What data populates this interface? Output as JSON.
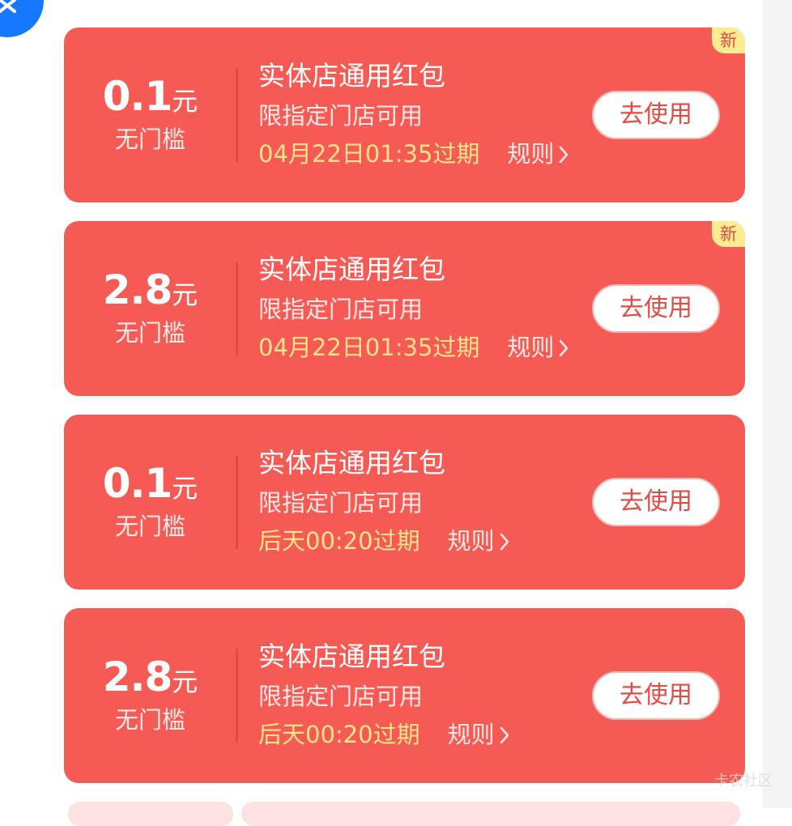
{
  "coupons": [
    {
      "amount": "0.1",
      "unit": "元",
      "threshold": "无门槛",
      "title": "实体店通用红包",
      "desc": "限指定门店可用",
      "expiry": "04月22日01:35过期",
      "rules_label": "规则",
      "button_label": "去使用",
      "badge": "新"
    },
    {
      "amount": "2.8",
      "unit": "元",
      "threshold": "无门槛",
      "title": "实体店通用红包",
      "desc": "限指定门店可用",
      "expiry": "04月22日01:35过期",
      "rules_label": "规则",
      "button_label": "去使用",
      "badge": "新"
    },
    {
      "amount": "0.1",
      "unit": "元",
      "threshold": "无门槛",
      "title": "实体店通用红包",
      "desc": "限指定门店可用",
      "expiry": "后天00:20过期",
      "rules_label": "规则",
      "button_label": "去使用"
    },
    {
      "amount": "2.8",
      "unit": "元",
      "threshold": "无门槛",
      "title": "实体店通用红包",
      "desc": "限指定门店可用",
      "expiry": "后天00:20过期",
      "rules_label": "规则",
      "button_label": "去使用"
    }
  ],
  "icons": {
    "corner": "close-icon",
    "rules": "chevron-right-icon"
  },
  "colors": {
    "card": "#f65a55",
    "expiry_text": "#ffe48a",
    "button_text": "#e34b44",
    "badge": "#ffec8f",
    "corner_icon": "#1677ff"
  },
  "watermark": "卡农社区"
}
